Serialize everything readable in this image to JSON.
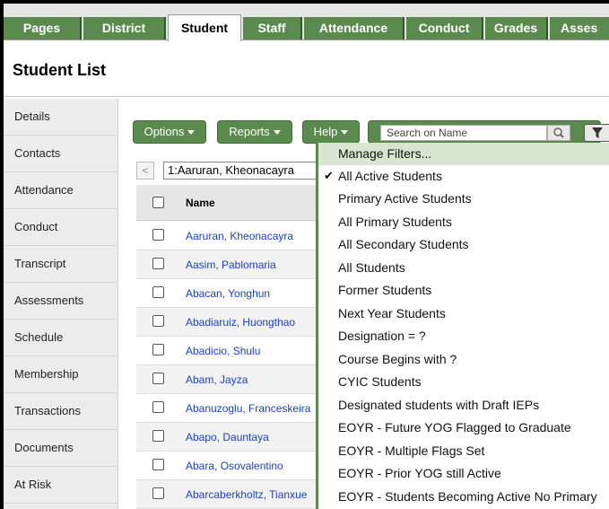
{
  "tabs": [
    "Pages",
    "District",
    "Student",
    "Staff",
    "Attendance",
    "Conduct",
    "Grades",
    "Asses"
  ],
  "active_tab": "Student",
  "page_title": "Student List",
  "sidebar": [
    "Details",
    "Contacts",
    "Attendance",
    "Conduct",
    "Transcript",
    "Assessments",
    "Schedule",
    "Membership",
    "Transactions",
    "Documents",
    "At Risk"
  ],
  "toolbar": {
    "options": "Options",
    "reports": "Reports",
    "help": "Help",
    "search_placeholder": "Search on Name"
  },
  "nav": {
    "prev": "<",
    "current_student": "1:Aaruran, Kheonacayra"
  },
  "table": {
    "header_name": "Name",
    "rows": [
      "Aaruran, Kheonacayra",
      "Aasim, Pablomaria",
      "Abacan, Yonghun",
      "Abadiaruiz, Huongthao",
      "Abadicio, Shulu",
      "Abam, Jayza",
      "Abanuzoglu, Franceskeira",
      "Abapo, Dauntaya",
      "Abara, Osovalentino",
      "Abarcaberkholtz, Tianxue"
    ]
  },
  "filter_menu": {
    "items": [
      "Manage Filters...",
      "All Active Students",
      "Primary Active Students",
      "All Primary Students",
      "All Secondary Students",
      "All Students",
      "Former Students",
      "Next Year Students",
      "Designation = ?",
      "Course Begins with ?",
      "CYIC Students",
      "Designated students with Draft IEPs",
      "EOYR - Future YOG Flagged to Graduate",
      "EOYR - Multiple Flags Set",
      "EOYR - Prior YOG still Active",
      "EOYR - Students Becoming Active No Primary"
    ],
    "checked_item": "All Active Students",
    "highlighted_item": "Manage Filters..."
  },
  "colors": {
    "tab_green": "#5b8a4f",
    "link_blue": "#1a3fbf",
    "menu_highlight": "#d8e6cf"
  }
}
